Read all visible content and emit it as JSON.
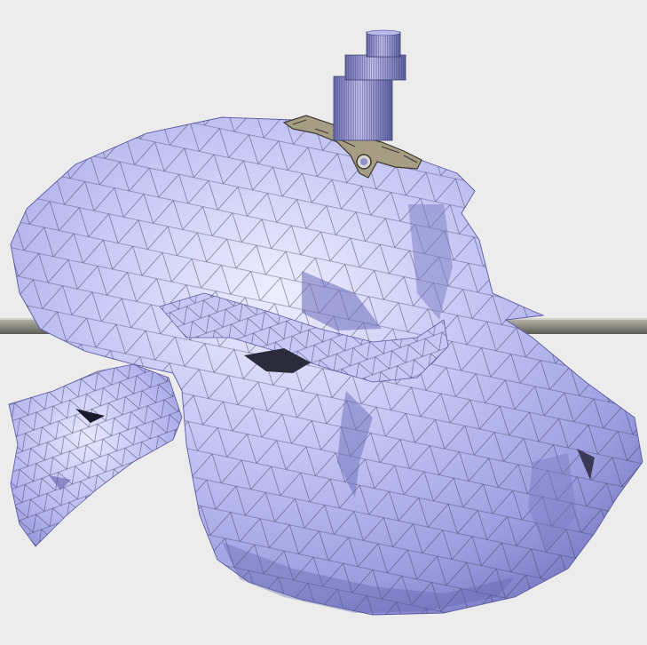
{
  "scene": {
    "background_color": "#ececec",
    "mesh_color": "#b7b8ef",
    "mesh_shadow_color": "#7d7fc9",
    "wire_color": "#2a2a44",
    "rod_color": "#8e8e84",
    "implant_color": "#9a9180",
    "pin_color": "#8f90cc",
    "icons": [
      "skull-mesh-icon",
      "cylindrical-pin-icon",
      "mesh-implant-icon",
      "horizontal-rod-icon"
    ]
  }
}
